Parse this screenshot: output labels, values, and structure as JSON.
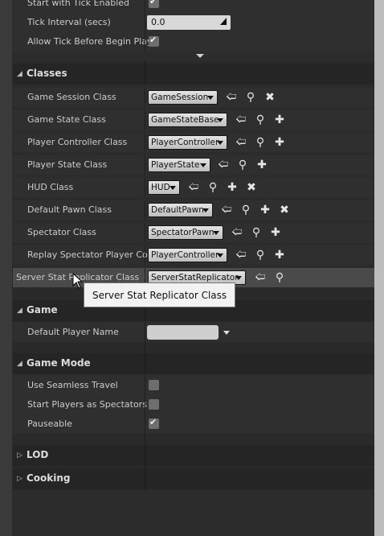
{
  "top_rows": [
    {
      "label": "Start with Tick Enabled",
      "checked": true
    },
    {
      "label": "Tick Interval (secs)",
      "value": "0.0"
    },
    {
      "label": "Allow Tick Before Begin Play",
      "checked": true
    }
  ],
  "categories": {
    "classes": "Classes",
    "game": "Game",
    "game_mode": "Game Mode",
    "lod": "LOD",
    "cooking": "Cooking"
  },
  "classes": [
    {
      "label": "Game Session Class",
      "value": "GameSession",
      "icons": [
        "arrow-left-icon",
        "search-icon",
        "clear-icon"
      ]
    },
    {
      "label": "Game State Class",
      "value": "GameStateBase",
      "icons": [
        "arrow-left-icon",
        "search-icon",
        "add-icon"
      ]
    },
    {
      "label": "Player Controller Class",
      "value": "PlayerController",
      "icons": [
        "arrow-left-icon",
        "search-icon",
        "add-icon"
      ]
    },
    {
      "label": "Player State Class",
      "value": "PlayerState",
      "icons": [
        "arrow-left-icon",
        "search-icon",
        "add-icon"
      ]
    },
    {
      "label": "HUD Class",
      "value": "HUD",
      "icons": [
        "arrow-left-icon",
        "search-icon",
        "add-icon",
        "clear-icon"
      ]
    },
    {
      "label": "Default Pawn Class",
      "value": "DefaultPawn",
      "icons": [
        "arrow-left-icon",
        "search-icon",
        "add-icon",
        "clear-icon"
      ]
    },
    {
      "label": "Spectator Class",
      "value": "SpectatorPawn",
      "icons": [
        "arrow-left-icon",
        "search-icon",
        "add-icon"
      ]
    },
    {
      "label": "Replay Spectator Player Cont",
      "value": "PlayerController",
      "icons": [
        "arrow-left-icon",
        "search-icon",
        "add-icon"
      ]
    },
    {
      "label": "Server Stat Replicator Class",
      "value": "ServerStatReplicator",
      "icons": [
        "arrow-left-icon",
        "search-icon"
      ]
    }
  ],
  "game": {
    "default_player_name_label": "Default Player Name",
    "default_player_name_value": ""
  },
  "game_mode": [
    {
      "label": "Use Seamless Travel",
      "checked": false
    },
    {
      "label": "Start Players as Spectators",
      "checked": false
    },
    {
      "label": "Pauseable",
      "checked": true
    }
  ],
  "tooltip": "Server Stat Replicator Class",
  "colors": {
    "panel": "#2c2c2c",
    "category": "#252525",
    "highlight": "#4a4a4a",
    "combo": "#d6d6d6"
  }
}
